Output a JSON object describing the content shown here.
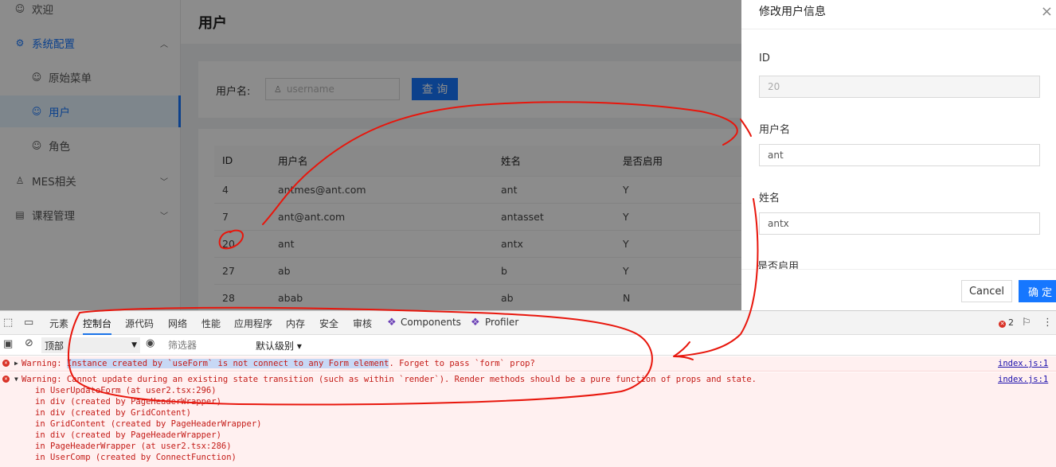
{
  "sidebar": {
    "items": [
      {
        "label": "欢迎",
        "icon": "smile-icon"
      },
      {
        "label": "系统配置",
        "icon": "setting-icon"
      },
      {
        "label": "原始菜单",
        "icon": "smile-icon"
      },
      {
        "label": "用户",
        "icon": "smile-icon"
      },
      {
        "label": "角色",
        "icon": "smile-icon"
      },
      {
        "label": "MES相关",
        "icon": "user-icon"
      },
      {
        "label": "课程管理",
        "icon": "book-icon"
      }
    ]
  },
  "page": {
    "title": "用户",
    "search_label": "用户名:",
    "search_placeholder": "username",
    "search_button": "查 询"
  },
  "table": {
    "columns": [
      "ID",
      "用户名",
      "姓名",
      "是否启用"
    ],
    "rows": [
      [
        "4",
        "antmes@ant.com",
        "ant",
        "Y"
      ],
      [
        "7",
        "ant@ant.com",
        "antasset",
        "Y"
      ],
      [
        "20",
        "ant",
        "antx",
        "Y"
      ],
      [
        "27",
        "ab",
        "b",
        "Y"
      ],
      [
        "28",
        "abab",
        "ab",
        "N"
      ]
    ]
  },
  "drawer": {
    "title": "修改用户信息",
    "close": "×",
    "fields": [
      {
        "label": "ID",
        "value": "20"
      },
      {
        "label": "用户名",
        "value": "ant"
      },
      {
        "label": "姓名",
        "value": "antx"
      },
      {
        "label": "是否启用"
      }
    ],
    "cancel": "Cancel",
    "ok": "确 定"
  },
  "devtools": {
    "tabs": [
      "元素",
      "控制台",
      "源代码",
      "网络",
      "性能",
      "应用程序",
      "内存",
      "安全",
      "审核",
      "Components",
      "Profiler"
    ],
    "error_count": "2",
    "context": "顶部",
    "filter_placeholder": "筛选器",
    "level": "默认级别 ▾",
    "messages": [
      {
        "prefix": "Warning: ",
        "highlight": "Instance created by `useForm` is not connect to any Form element",
        "rest": ". Forget to pass `form` prop?",
        "source": "index.js:1"
      },
      {
        "prefix": "Warning: ",
        "rest": "Cannot update during an existing state transition (such as within `render`). Render methods should be a pure function of props and state.",
        "source": "index.js:1",
        "stack": [
          "in UserUpdateForm (at user2.tsx:296)",
          "in div (created by PageHeaderWrapper)",
          "in div (created by GridContent)",
          "in GridContent (created by PageHeaderWrapper)",
          "in div (created by PageHeaderWrapper)",
          "in PageHeaderWrapper (at user2.tsx:286)",
          "in UserComp (created by ConnectFunction)"
        ]
      }
    ]
  },
  "colors": {
    "primary": "#1677ff",
    "error": "#c41a16",
    "annotation": "#e8160c"
  }
}
